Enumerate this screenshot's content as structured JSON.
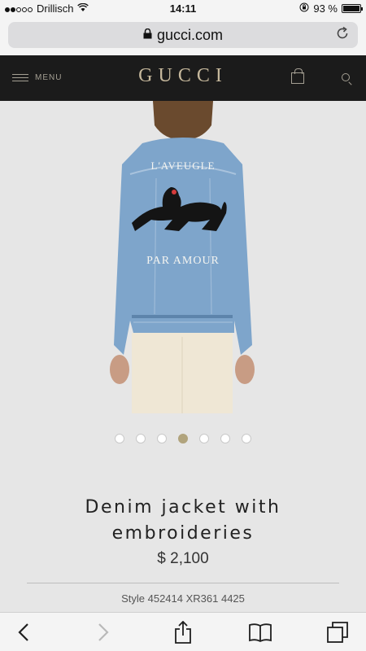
{
  "status": {
    "carrier": "Drillisch",
    "time": "14:11",
    "battery": "93 %",
    "battery_level": 0.93,
    "signal_bars_on": 2,
    "signal_bars_total": 5
  },
  "browser": {
    "url": "gucci.com"
  },
  "site_nav": {
    "menu_label": "MENU",
    "logo": "GUCCI"
  },
  "product": {
    "title_line1": "Denim jacket with",
    "title_line2": "embroideries",
    "price": "$ 2,100",
    "style": "Style 452414 XR361 4425",
    "embroidery_top": "L'AVEUGLE",
    "embroidery_bottom": "PAR AMOUR",
    "image_count": 7,
    "active_image": 4
  },
  "colors": {
    "nav_bg": "#1b1b1b",
    "logo": "#c6b89c",
    "pager_active": "#b1a47d",
    "denim": "#7fa6cc"
  }
}
